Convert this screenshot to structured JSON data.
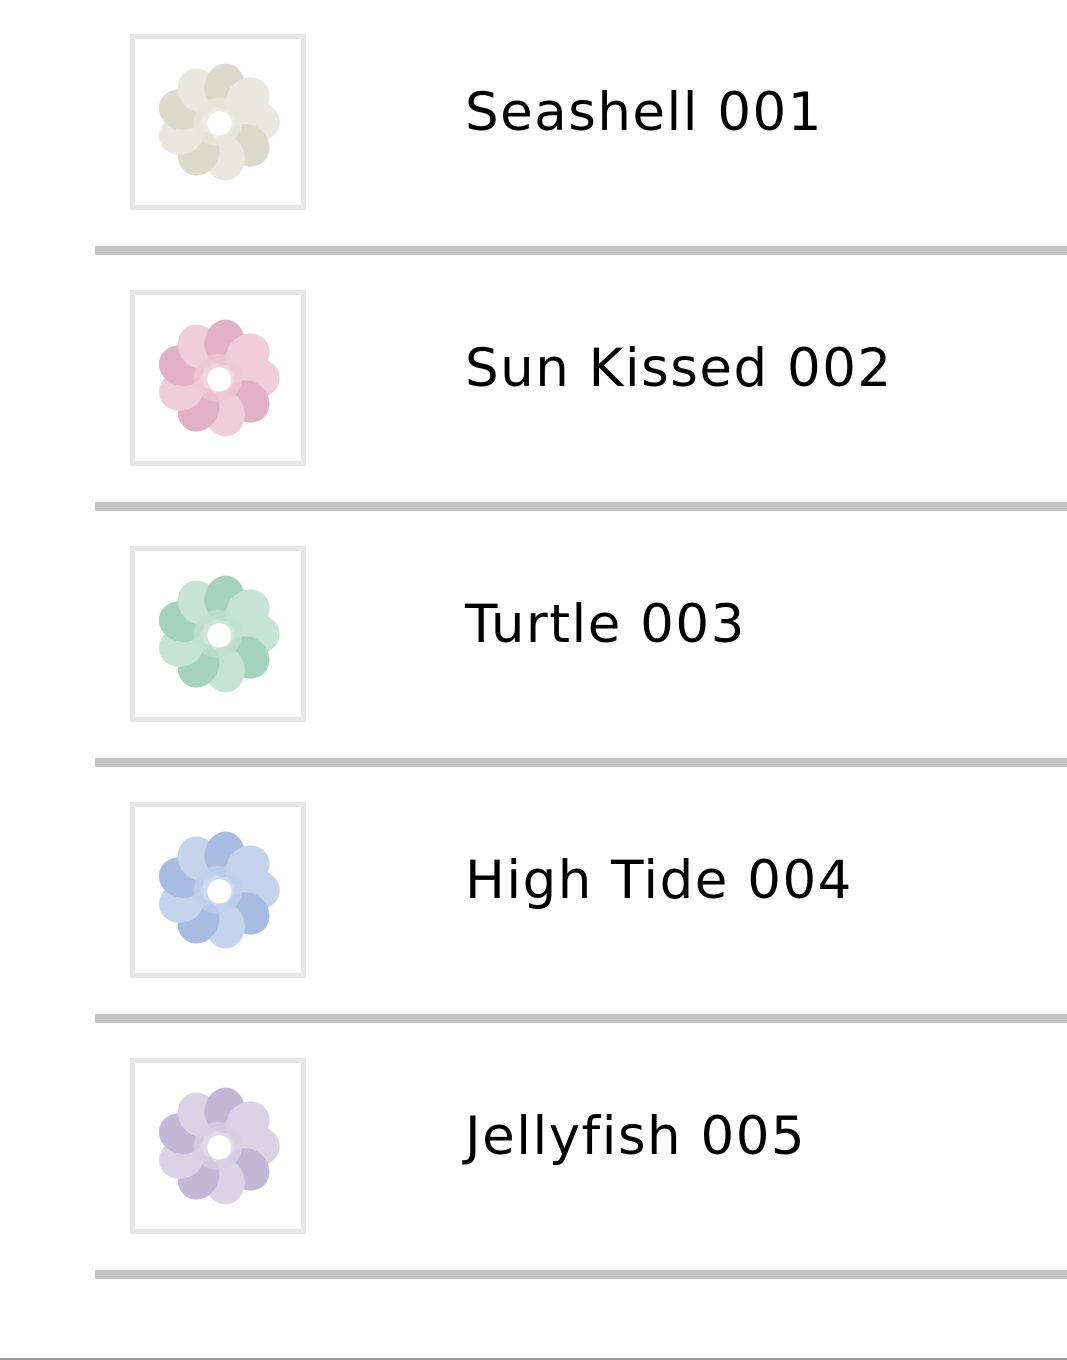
{
  "items": [
    {
      "label": "Seashell 001",
      "color": "#e7e6dc",
      "shade": "#d7d6c8"
    },
    {
      "label": "Sun Kissed 002",
      "color": "#eec9d6",
      "shade": "#dfa9bd"
    },
    {
      "label": "Turtle 003",
      "color": "#bfe0d3",
      "shade": "#9ccdb9"
    },
    {
      "label": "High Tide 004",
      "color": "#bfd0ec",
      "shade": "#9fb5de"
    },
    {
      "label": "Jellyfish 005",
      "color": "#d8cfe3",
      "shade": "#bcb0d1"
    }
  ],
  "icons": {
    "product_thumbnail": "scrunchie-icon"
  }
}
